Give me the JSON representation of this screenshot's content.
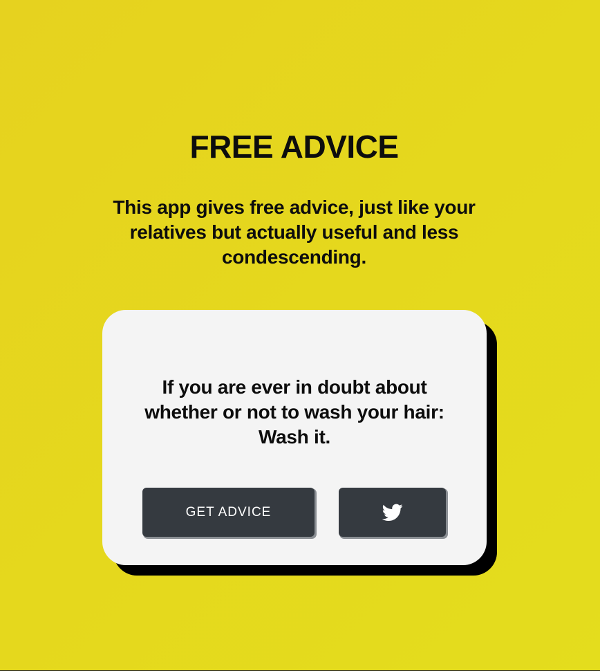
{
  "header": {
    "title": "FREE ADVICE",
    "subtitle": "This app gives free advice, just like your relatives but actually useful and less condescending."
  },
  "card": {
    "advice_text": "If you are ever in doubt about whether or not to wash your hair: Wash it.",
    "get_advice_label": "GET ADVICE",
    "tweet_icon": "twitter-icon"
  },
  "colors": {
    "background": "#e5d81d",
    "card": "#f4f4f4",
    "card_shadow": "#000000",
    "button": "#353a40",
    "button_text": "#ffffff"
  }
}
